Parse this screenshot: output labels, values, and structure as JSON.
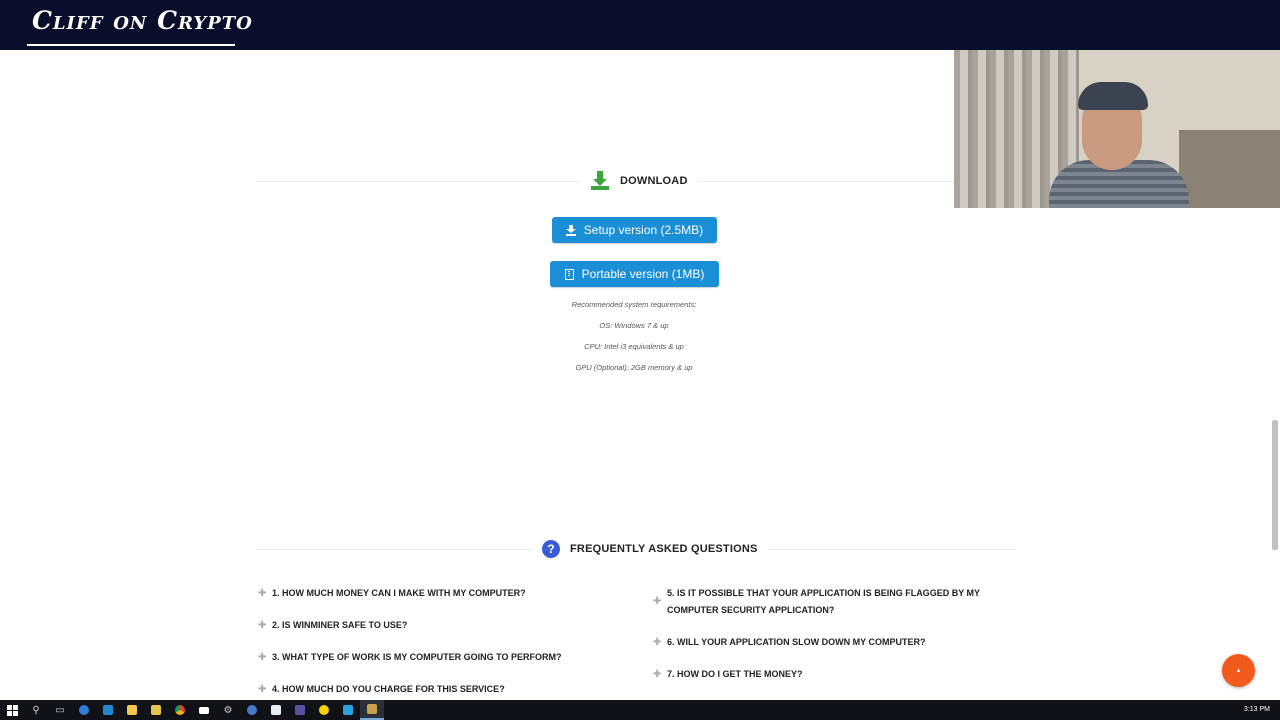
{
  "banner": {
    "title": "Cliff on Crypto"
  },
  "download_section": {
    "heading": "DOWNLOAD",
    "setup_button": "Setup version (2.5MB)",
    "portable_button": "Portable version (1MB)",
    "requirements": [
      "Recommended system requirements:",
      "OS: Windows 7 & up",
      "CPU: Intel i3 equivalents & up",
      "GPU (Optional): 2GB memory & up"
    ]
  },
  "faq_section": {
    "heading": "FREQUENTLY ASKED QUESTIONS",
    "left_items": [
      "1. HOW MUCH MONEY CAN I MAKE WITH MY COMPUTER?",
      "2. IS WINMINER SAFE TO USE?",
      "3. WHAT TYPE OF WORK IS MY COMPUTER GOING TO PERFORM?",
      "4. HOW MUCH DO YOU CHARGE FOR THIS SERVICE?"
    ],
    "right_items": [
      "5. IS IT POSSIBLE THAT YOUR APPLICATION IS BEING FLAGGED BY MY COMPUTER SECURITY APPLICATION?",
      "6. WILL YOUR APPLICATION SLOW DOWN MY COMPUTER?",
      "7. HOW DO I GET THE MONEY?"
    ]
  },
  "taskbar": {
    "clock": "3:13 PM",
    "apps": [
      "start-icon",
      "search-icon",
      "task-view-icon",
      "edge-icon",
      "store-icon",
      "file-explorer-icon",
      "shopping-bag-icon",
      "chrome-icon",
      "mail-icon",
      "settings-icon",
      "network-icon",
      "notepad-icon",
      "app-icon",
      "norton-icon",
      "app-blue-icon",
      "miner-icon"
    ]
  },
  "colors": {
    "banner_bg": "#0b0e2a",
    "button_blue": "#1a8fd6",
    "download_green": "#3da33d",
    "faq_icon_blue": "#3b5bd6",
    "scroll_top_orange": "#f25a1d"
  }
}
